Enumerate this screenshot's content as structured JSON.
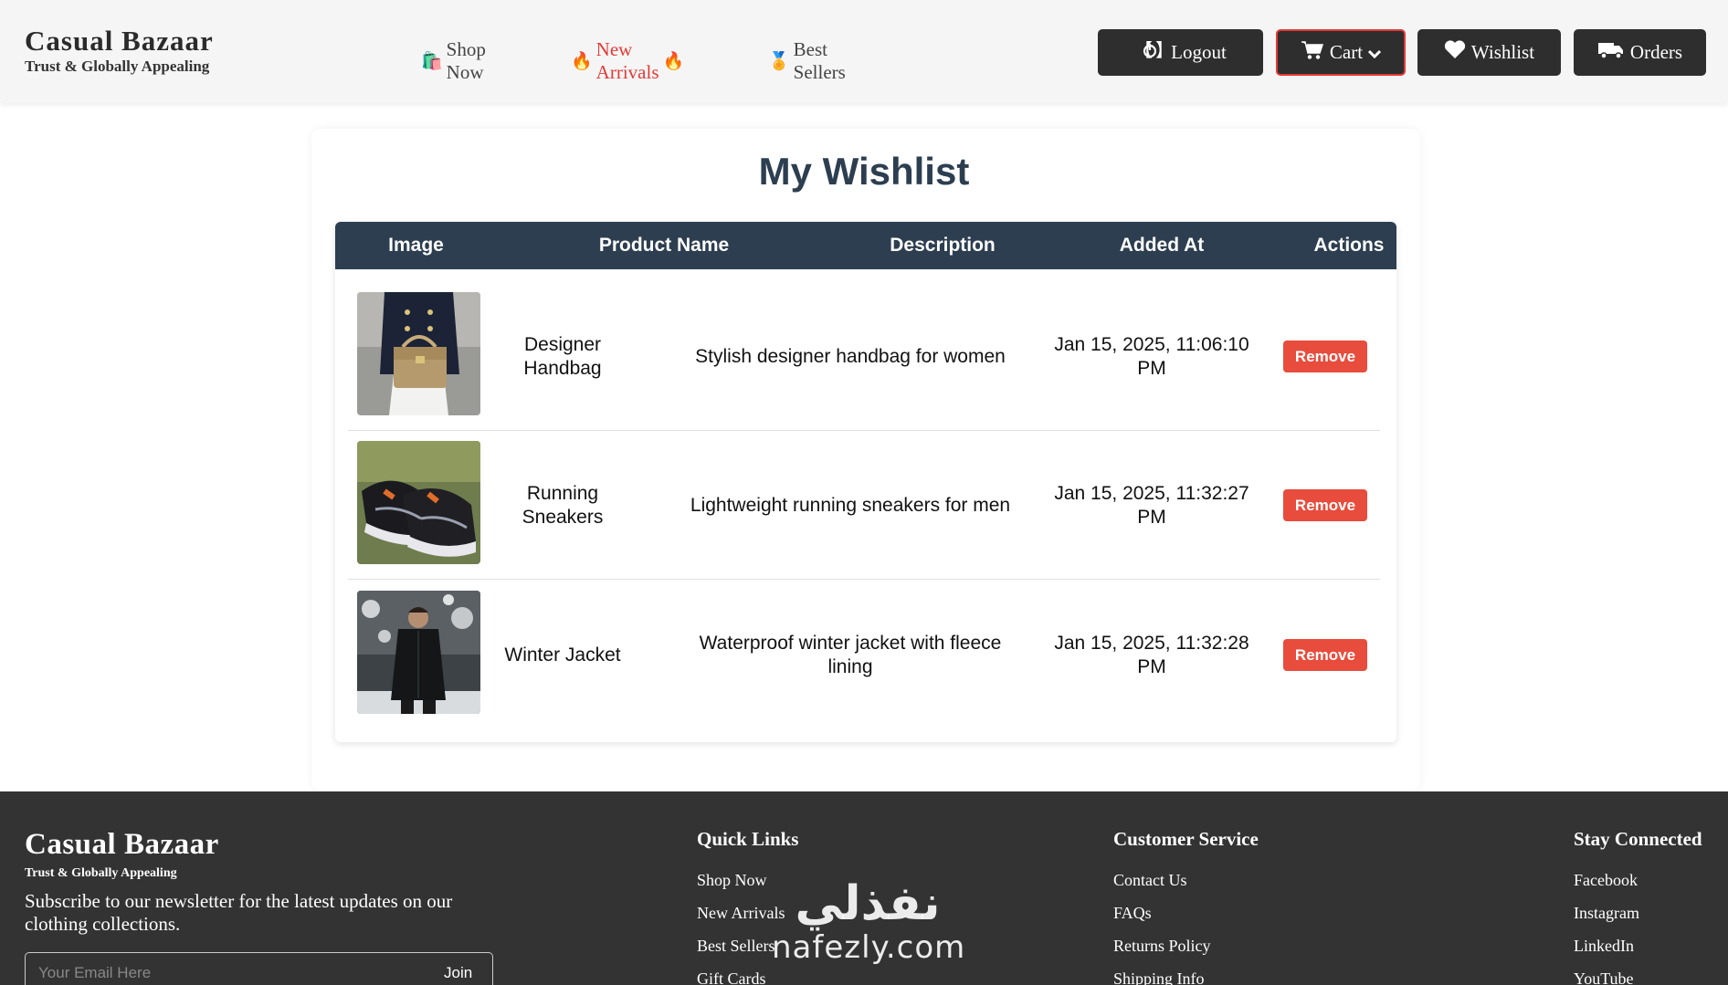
{
  "header": {
    "brand_name": "Casual Bazaar",
    "brand_tagline": "Trust & Globally Appealing",
    "nav": [
      {
        "label": "Shop Now",
        "icon": "shopping-bag-icon"
      },
      {
        "label": "New Arrivals",
        "icon": "fire-icon",
        "color": "#e53935"
      },
      {
        "label": "Best Sellers",
        "icon": "medal-icon"
      }
    ],
    "buttons": {
      "logout": "Logout",
      "cart": "Cart",
      "wishlist": "Wishlist",
      "orders": "Orders"
    }
  },
  "main": {
    "title": "My Wishlist",
    "columns": [
      "Image",
      "Product Name",
      "Description",
      "Added At",
      "Actions"
    ],
    "rows": [
      {
        "name": "Designer Handbag",
        "description": "Stylish designer handbag for women",
        "added_at": "Jan 15, 2025, 11:06:10 PM",
        "action": "Remove"
      },
      {
        "name": "Running Sneakers",
        "description": "Lightweight running sneakers for men",
        "added_at": "Jan 15, 2025, 11:32:27 PM",
        "action": "Remove"
      },
      {
        "name": "Winter Jacket",
        "description": "Waterproof winter jacket with fleece lining",
        "added_at": "Jan 15, 2025, 11:32:28 PM",
        "action": "Remove"
      }
    ]
  },
  "footer": {
    "brand_name": "Casual Bazaar",
    "brand_tagline": "Trust & Globally Appealing",
    "newsletter_text": "Subscribe to our newsletter for the latest updates on our clothing collections.",
    "email_placeholder": "Your Email Here",
    "join_label": "Join",
    "quick_links": {
      "title": "Quick Links",
      "items": [
        "Shop Now",
        "New Arrivals",
        "Best Sellers",
        "Gift Cards"
      ]
    },
    "customer_service": {
      "title": "Customer Service",
      "items": [
        "Contact Us",
        "FAQs",
        "Returns Policy",
        "Shipping Info"
      ]
    },
    "stay_connected": {
      "title": "Stay Connected",
      "items": [
        "Facebook",
        "Instagram",
        "LinkedIn",
        "YouTube"
      ]
    }
  },
  "watermark": {
    "arabic": "نفذلي",
    "latin": "nafezly.com"
  },
  "colors": {
    "accent_red": "#e53935",
    "table_header": "#2c3e50",
    "remove_button": "#e74c3c",
    "footer_bg": "#333333"
  }
}
